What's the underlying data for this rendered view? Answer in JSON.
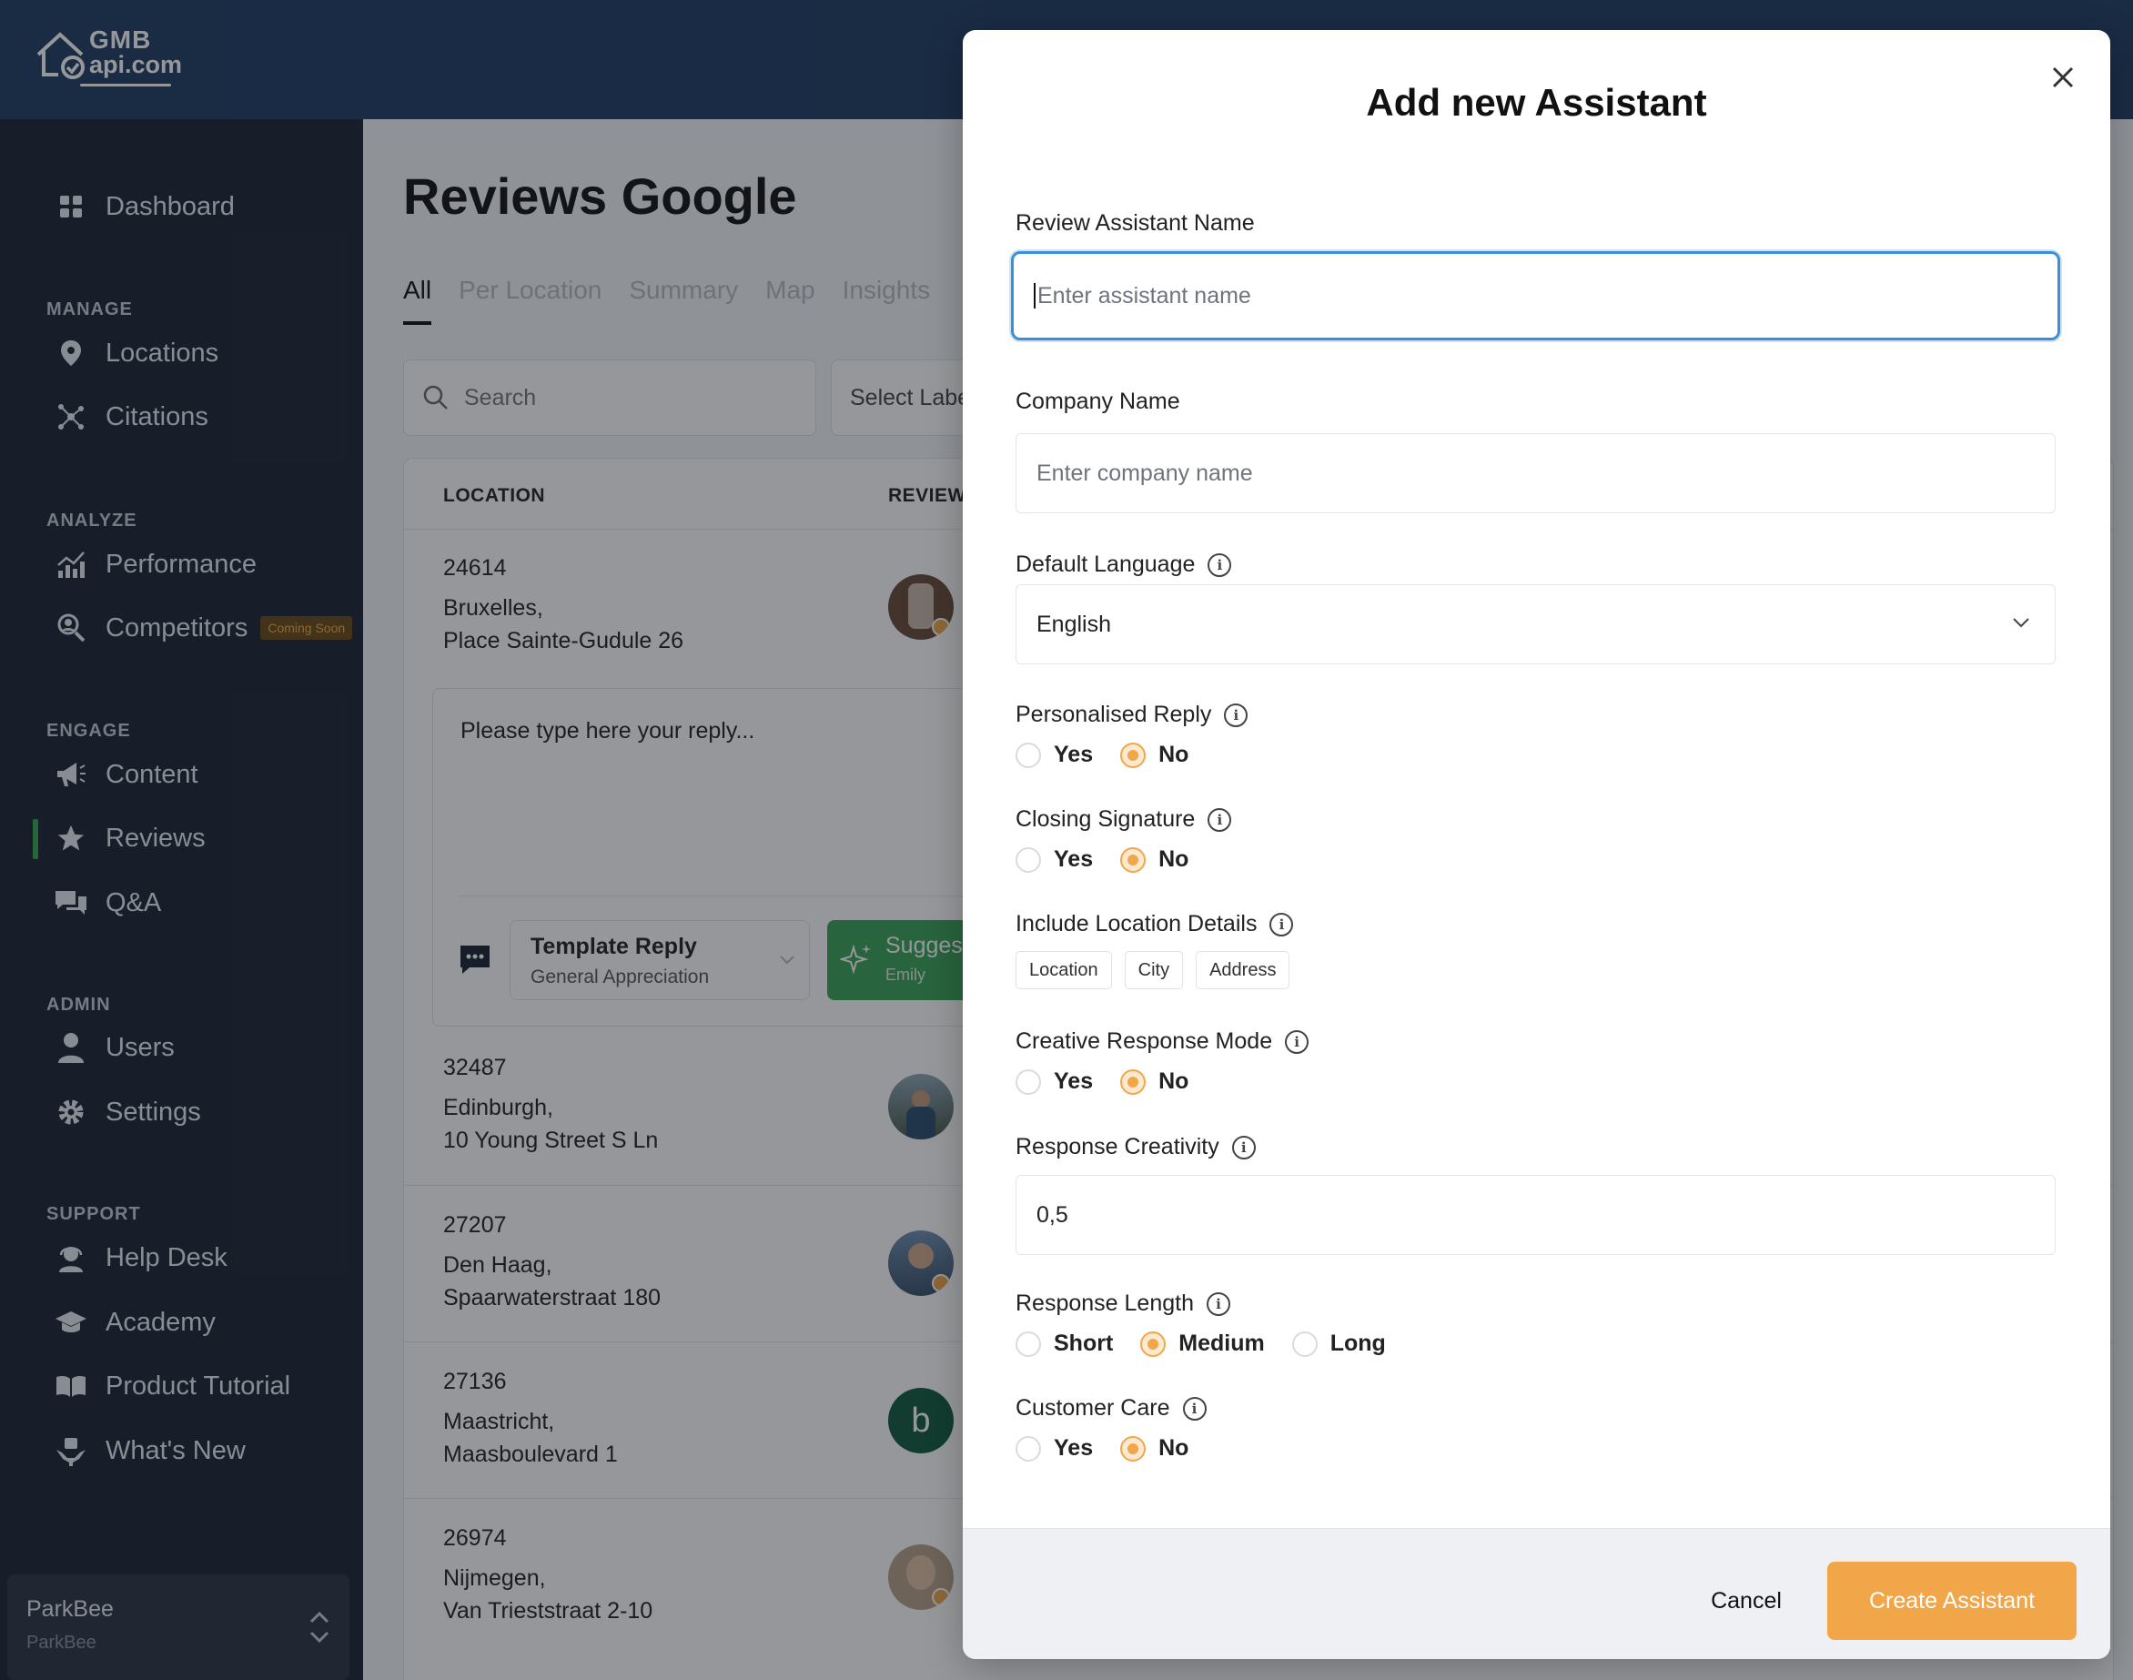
{
  "logo": {
    "line1": "GMB",
    "line2": "api.com"
  },
  "sidebar": {
    "items": {
      "dashboard": "Dashboard",
      "locations": "Locations",
      "citations": "Citations",
      "performance": "Performance",
      "competitors": "Competitors",
      "content": "Content",
      "reviews": "Reviews",
      "qa": "Q&A",
      "users": "Users",
      "settings": "Settings",
      "helpdesk": "Help Desk",
      "academy": "Academy",
      "tutorial": "Product Tutorial",
      "whatsnew": "What's New"
    },
    "sections": {
      "manage": "MANAGE",
      "analyze": "ANALYZE",
      "engage": "ENGAGE",
      "admin": "ADMIN",
      "support": "SUPPORT"
    },
    "coming_soon": "Coming Soon",
    "account": {
      "name": "ParkBee",
      "sub": "ParkBee"
    }
  },
  "main": {
    "title": "Reviews Google",
    "tabs": [
      "All",
      "Per Location",
      "Summary",
      "Map",
      "Insights"
    ],
    "search_placeholder": "Search",
    "select_label": "Select Labe",
    "table": {
      "col_location": "LOCATION",
      "col_review": "REVIEW",
      "rows": [
        {
          "id": "24614",
          "city": "Bruxelles,",
          "address": "Place Sainte-Gudule 26"
        },
        {
          "id": "32487",
          "city": "Edinburgh,",
          "address": "10 Young Street S Ln"
        },
        {
          "id": "27207",
          "city": "Den Haag,",
          "address": "Spaarwaterstraat 180"
        },
        {
          "id": "27136",
          "city": "Maastricht,",
          "address": "Maasboulevard 1"
        },
        {
          "id": "26974",
          "city": "Nijmegen,",
          "address": "Van Triestst​raat 2-10"
        }
      ],
      "avatar_letter": "b"
    },
    "reply": {
      "placeholder": "Please type here your reply...",
      "template_title": "Template Reply",
      "template_sub": "General Appreciation",
      "suggest_title": "Sugges",
      "suggest_sub": "Emily"
    }
  },
  "modal": {
    "title": "Add new Assistant",
    "assistant_name_label": "Review Assistant Name",
    "assistant_name_placeholder": "Enter assistant name",
    "company_label": "Company Name",
    "company_placeholder": "Enter company name",
    "language_label": "Default Language",
    "language_value": "English",
    "personalised_label": "Personalised Reply",
    "closing_label": "Closing Signature",
    "location_details_label": "Include Location Details",
    "location_chips": [
      "Location",
      "City",
      "Address"
    ],
    "creative_label": "Creative Response Mode",
    "creativity_label": "Response Creativity",
    "creativity_value": "0,5",
    "length_label": "Response Length",
    "length_options": [
      "Short",
      "Medium",
      "Long"
    ],
    "length_selected": "Medium",
    "care_label": "Customer Care",
    "yes": "Yes",
    "no": "No",
    "cancel": "Cancel",
    "create": "Create Assistant"
  },
  "colors": {
    "accent": "#f2a64a",
    "focus": "#3b8fd9",
    "sidebar": "#1b2433",
    "topbar": "#1f3b63",
    "success": "#3aa357"
  }
}
